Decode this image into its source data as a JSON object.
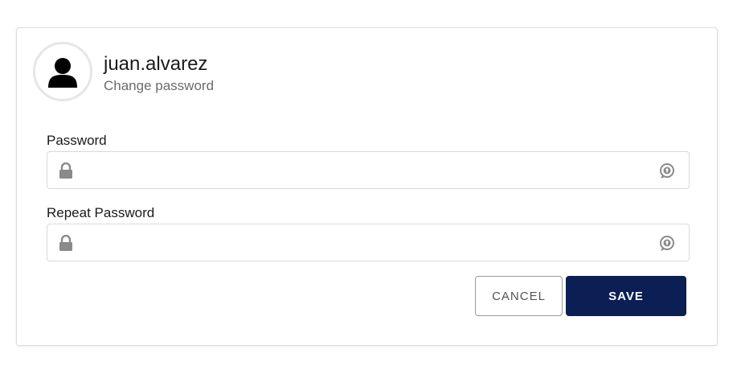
{
  "profile": {
    "username": "juan.alvarez",
    "subtitle": "Change password"
  },
  "form": {
    "password": {
      "label": "Password",
      "value": "",
      "placeholder": "",
      "leading_icon": "lock-icon",
      "trailing_icon": "reveal-password-icon"
    },
    "repeat_password": {
      "label": "Repeat Password",
      "value": "",
      "placeholder": "",
      "leading_icon": "lock-icon",
      "trailing_icon": "reveal-password-icon"
    }
  },
  "actions": {
    "cancel_label": "CANCEL",
    "save_label": "SAVE"
  },
  "colors": {
    "primary": "#0b1f55",
    "border": "#d9d9d9",
    "icon": "#8a8a8a",
    "text": "#1a1a1a",
    "muted_text": "#6b6b6b"
  }
}
